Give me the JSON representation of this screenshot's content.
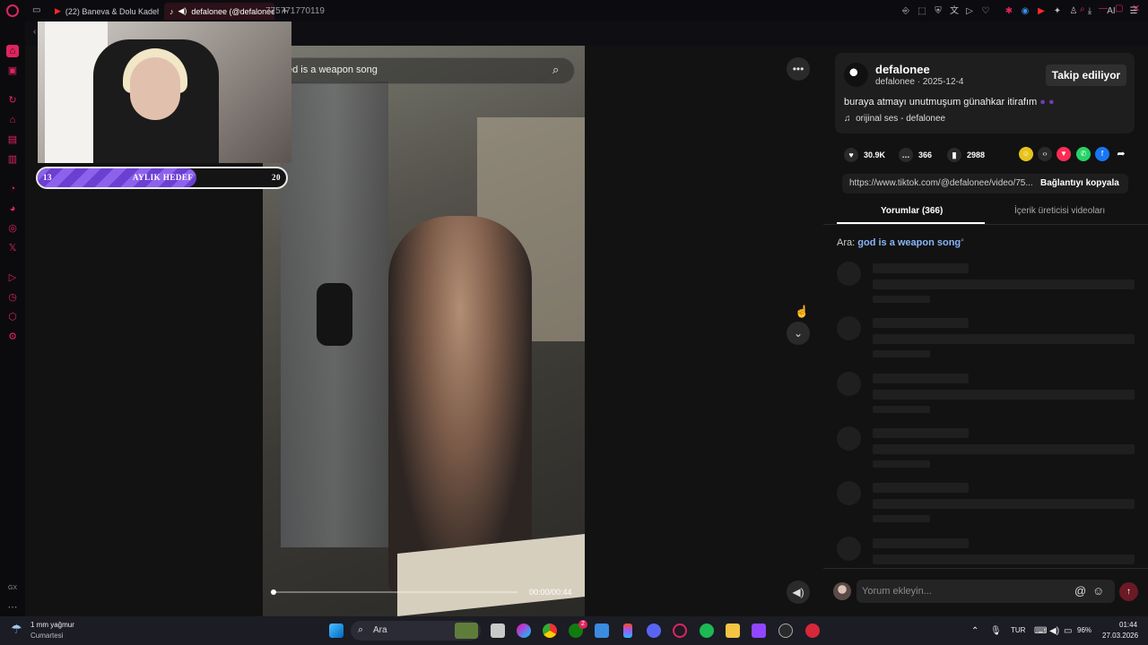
{
  "browser": {
    "tabs": [
      {
        "label": "(22) Baneva & Dolu Kadeh",
        "active": false
      },
      {
        "label": "defalonee (@defalonee",
        "active": true
      }
    ],
    "url": "775771770119",
    "extension_ai_label": "AI"
  },
  "sidebar": {
    "icons": [
      "home-icon",
      "window-icon",
      "refresh-icon",
      "bag-icon",
      "layers-icon",
      "notes-icon",
      "messenger-icon",
      "whatsapp-icon",
      "instagram-icon",
      "x-icon",
      "play-icon",
      "history-icon",
      "cube-icon",
      "settings-icon"
    ],
    "bottom_label": "GX"
  },
  "webcam": {
    "goal": {
      "start": "13",
      "label": "AYLIK HEDEF",
      "end": "20",
      "progress": 0.64
    }
  },
  "video": {
    "search_text": "ed is a weapon song",
    "timecode": "00:00/00:44",
    "progress": 0.0
  },
  "post": {
    "author": "defalonee",
    "author_sub": "defalonee · 2025-12-4",
    "follow_label": "Takip ediliyor",
    "caption": "buraya atmayı unutmuşum günahkar itirafım",
    "sound": "orijinal ses - defalonee",
    "likes": "30.9K",
    "comments": "366",
    "saves": "2988",
    "link": "https://www.tiktok.com/@defalonee/video/75...",
    "copy_label": "Bağlantıyı kopyala"
  },
  "panel": {
    "tabs": [
      "Yorumlar (366)",
      "İçerik üreticisi videoları"
    ],
    "search_prefix": "Ara:",
    "search_query": "god is a weapon song",
    "comment_placeholder": "Yorum ekleyin..."
  },
  "taskbar": {
    "weather_temp": "1 mm yağmur",
    "weather_day": "Cumartesi",
    "search_label": "Ara",
    "lang": "TUR",
    "battery": "96%",
    "time": "01:44",
    "date": "27.03.2026",
    "badge": "2"
  },
  "colors": {
    "accent": "#e0245e",
    "goal_purple": "#7a4fe0",
    "link_blue": "#8ab4f8"
  }
}
